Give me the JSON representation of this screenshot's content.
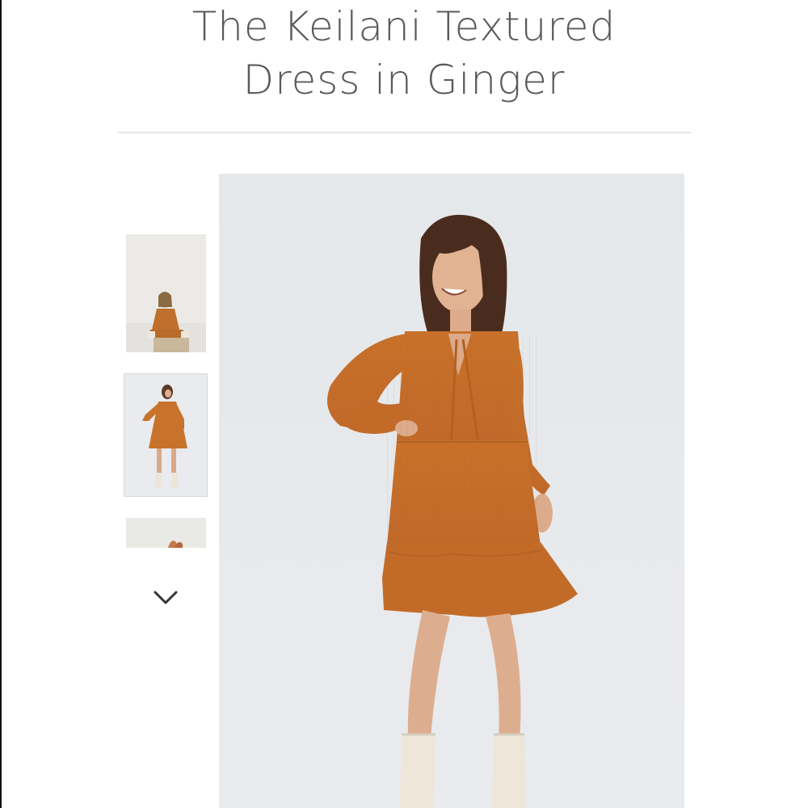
{
  "product": {
    "title_line_1": "The Keilani Textured",
    "title_line_2": "Dress in Ginger"
  },
  "gallery": {
    "thumbnails": [
      {
        "label": "thumbnail-seated-pose"
      },
      {
        "label": "thumbnail-standing-front",
        "selected": true
      },
      {
        "label": "thumbnail-partial"
      }
    ],
    "scroll_icon": "chevron-down-icon"
  },
  "colors": {
    "dress": "#c8732c",
    "background": "#e7e9ec",
    "title_text": "#5a5a5a"
  }
}
